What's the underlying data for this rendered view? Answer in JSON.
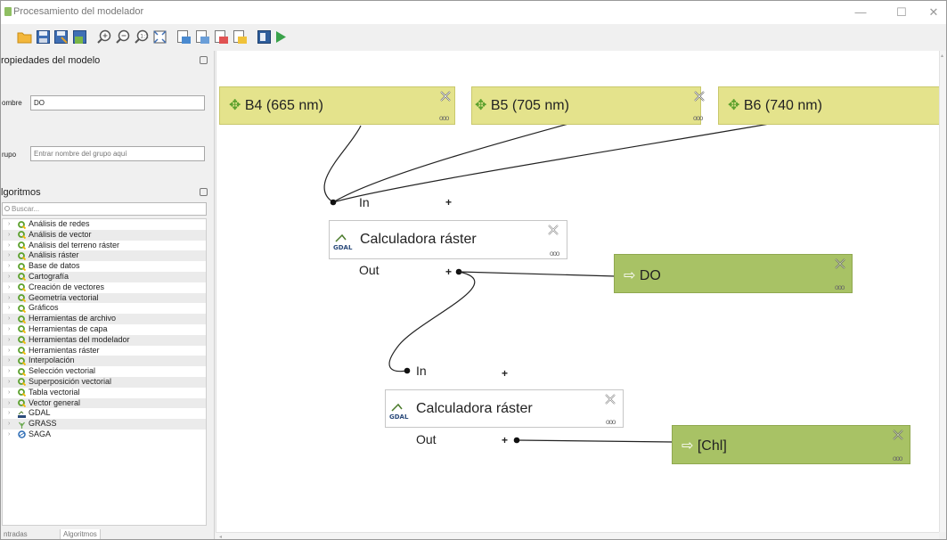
{
  "window": {
    "title": "Procesamiento del modelador",
    "minimize": "—",
    "maximize": "☐",
    "close": "✕"
  },
  "toolbar": {
    "icons": [
      "open-icon",
      "save-icon",
      "save-as-icon",
      "save-to-project-icon",
      "zoom-in-icon",
      "zoom-out-icon",
      "zoom-actual-icon",
      "zoom-full-icon",
      "export-image-icon",
      "export-pdf-icon",
      "export-svg-icon",
      "export-python-icon",
      "model-properties-icon",
      "run-model-icon"
    ]
  },
  "left_panel": {
    "properties_title": "ropiedades del modelo",
    "name_label": "ombre",
    "name_value": "DO",
    "group_label": "rupo",
    "group_placeholder": "Entrar nombre del grupo aquí",
    "algorithms_title": "lgoritmos",
    "search_placeholder": "Buscar...",
    "tree": [
      {
        "label": "Análisis de redes",
        "icon": "qgis-icon"
      },
      {
        "label": "Análisis de vector",
        "icon": "qgis-icon"
      },
      {
        "label": "Análisis del terreno ráster",
        "icon": "qgis-icon"
      },
      {
        "label": "Análisis ráster",
        "icon": "qgis-icon"
      },
      {
        "label": "Base de datos",
        "icon": "qgis-icon"
      },
      {
        "label": "Cartografía",
        "icon": "qgis-icon"
      },
      {
        "label": "Creación de vectores",
        "icon": "qgis-icon"
      },
      {
        "label": "Geometría vectorial",
        "icon": "qgis-icon"
      },
      {
        "label": "Gráficos",
        "icon": "qgis-icon"
      },
      {
        "label": "Herramientas de archivo",
        "icon": "qgis-icon"
      },
      {
        "label": "Herramientas de capa",
        "icon": "qgis-icon"
      },
      {
        "label": "Herramientas del modelador",
        "icon": "qgis-icon"
      },
      {
        "label": "Herramientas ráster",
        "icon": "qgis-icon"
      },
      {
        "label": "Interpolación",
        "icon": "qgis-icon"
      },
      {
        "label": "Selección vectorial",
        "icon": "qgis-icon"
      },
      {
        "label": "Superposición vectorial",
        "icon": "qgis-icon"
      },
      {
        "label": "Tabla vectorial",
        "icon": "qgis-icon"
      },
      {
        "label": "Vector general",
        "icon": "qgis-icon"
      },
      {
        "label": "GDAL",
        "icon": "gdal-icon"
      },
      {
        "label": "GRASS",
        "icon": "grass-icon"
      },
      {
        "label": "SAGA",
        "icon": "saga-icon"
      }
    ],
    "tabs": [
      "ntradas",
      "Algoritmos"
    ]
  },
  "canvas": {
    "inputs": [
      {
        "label": "B4 (665 nm)"
      },
      {
        "label": "B5 (705 nm)"
      },
      {
        "label": "B6 (740 nm)"
      }
    ],
    "algorithms": [
      {
        "label": "Calculadora ráster",
        "in": "In",
        "out": "Out",
        "icon_text": "GDAL"
      },
      {
        "label": "Calculadora ráster",
        "in": "In",
        "out": "Out",
        "icon_text": "GDAL"
      }
    ],
    "outputs": [
      {
        "label": "DO"
      },
      {
        "label": "[Chl]"
      }
    ],
    "plus": "+",
    "dots": "ooo"
  },
  "colors": {
    "input_fill": "#e4e38c",
    "output_fill": "#a8c265",
    "qgis_green": "#5aa02c",
    "run_green": "#3aa24a"
  }
}
